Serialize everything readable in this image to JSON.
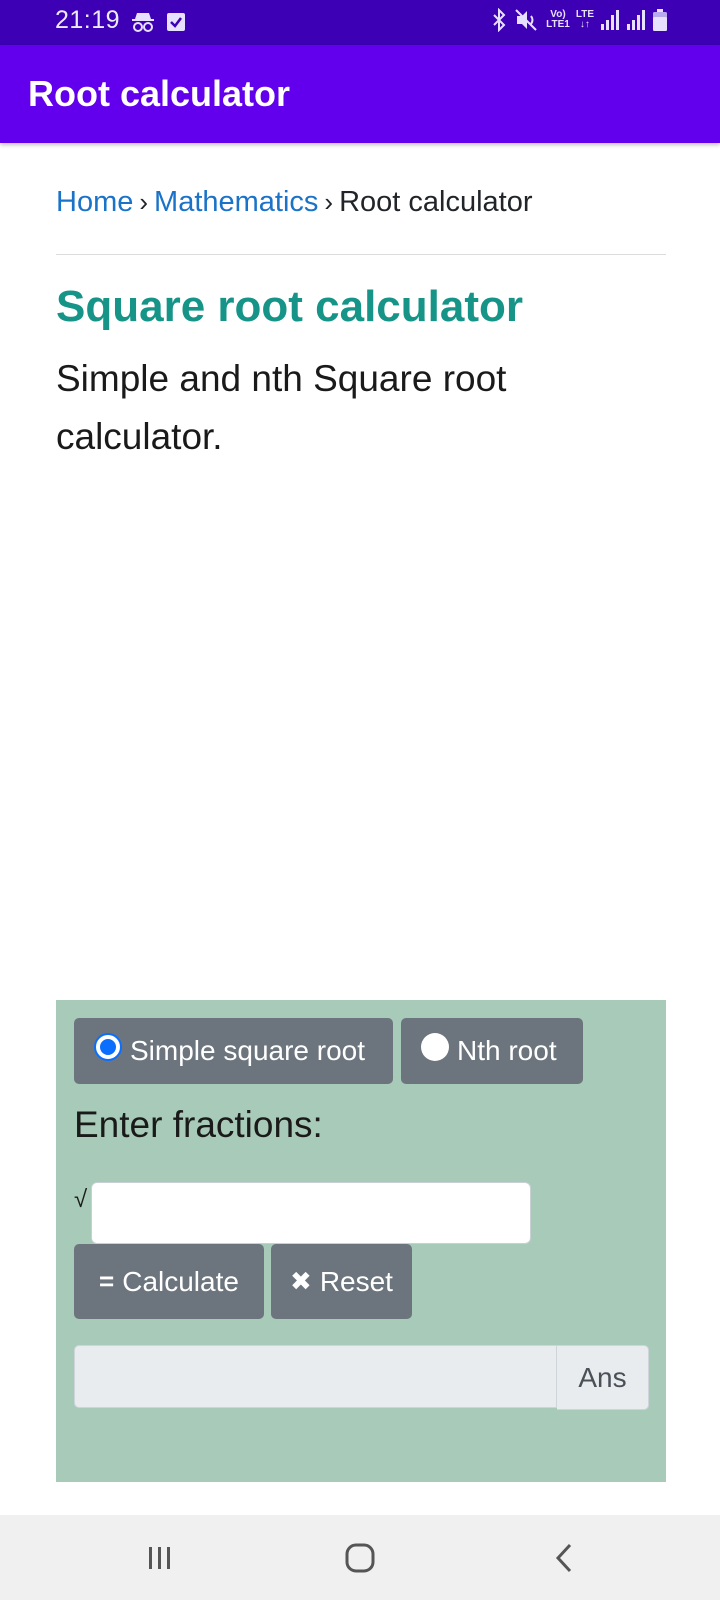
{
  "status_bar": {
    "time": "21:19",
    "left_icons": [
      "incognito-icon",
      "checkbox-icon"
    ],
    "right_icons": [
      "bluetooth-icon",
      "mute-icon",
      "volte-icon",
      "lte-icon",
      "signal-icon",
      "signal-icon",
      "battery-icon"
    ],
    "volte_line1": "Vo)",
    "volte_line2": "LTE1",
    "lte_label": "LTE"
  },
  "app_bar": {
    "title": "Root calculator"
  },
  "breadcrumb": {
    "home": "Home",
    "sep1": "›",
    "mathematics": "Mathematics",
    "sep2": "›",
    "current": "Root calculator"
  },
  "page": {
    "title": "Square root calculator",
    "description": "Simple and nth Square root calculator."
  },
  "calculator": {
    "mode_options": [
      {
        "label": "Simple square root",
        "selected": true
      },
      {
        "label": "Nth root",
        "selected": false
      }
    ],
    "input_label": "Enter fractions:",
    "sqrt_symbol": "√",
    "input_value": "",
    "calculate_label": "Calculate",
    "calculate_glyph": "=",
    "reset_label": "Reset",
    "reset_glyph": "✖",
    "answer_value": "",
    "answer_addon": "Ans"
  },
  "colors": {
    "status_bar": "#3d00b4",
    "app_bar": "#6200ee",
    "title_teal": "#159487",
    "link_blue": "#1a73c8",
    "panel_green": "#a8cab8",
    "button_gray": "#6c757d"
  },
  "nav_bar": {
    "buttons": [
      "recent-apps-icon",
      "home-icon",
      "back-icon"
    ]
  }
}
